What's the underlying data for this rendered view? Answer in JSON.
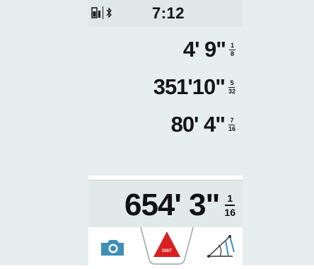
{
  "status": {
    "time": "7:12"
  },
  "measurements": [
    {
      "value": "4' 9\"",
      "num": "1",
      "den": "8"
    },
    {
      "value": "351'10\"",
      "num": "5",
      "den": "32"
    },
    {
      "value": "80' 4\"",
      "num": "7",
      "den": "16"
    }
  ],
  "total": {
    "value": "654' 3\"",
    "num": "1",
    "den": "16"
  },
  "toolbar": {
    "dist_label": "DIST",
    "icons": [
      "camera-icon",
      "distance-mode-icon",
      "angle-measure-icon"
    ]
  },
  "colors": {
    "panel_bg": "#e7efee",
    "accent_red": "#d8201e",
    "page_bg": "#e6efed"
  }
}
